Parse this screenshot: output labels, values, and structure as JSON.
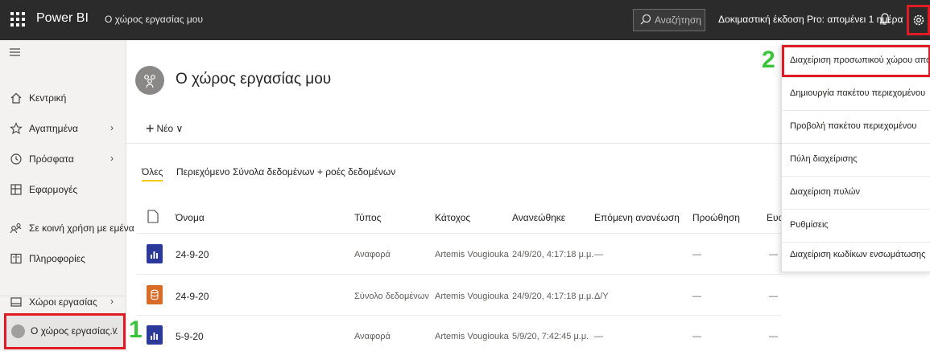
{
  "topbar": {
    "brand": "Power BI",
    "workspace_crumb": "Ο χώρος εργασίας μου",
    "search_placeholder": "Αναζήτηση",
    "trial_text": "Δοκιμαστική έκδοση Pro: απομένει 1 ημέρα"
  },
  "sidebar": {
    "items": [
      {
        "label": "Κεντρική",
        "icon": "home-icon"
      },
      {
        "label": "Αγαπημένα",
        "icon": "star-icon",
        "chevron": "›"
      },
      {
        "label": "Πρόσφατα",
        "icon": "clock-icon",
        "chevron": "›"
      },
      {
        "label": "Εφαρμογές",
        "icon": "apps-icon"
      },
      {
        "label": "Σε κοινή χρήση με εμένα",
        "icon": "shared-icon"
      },
      {
        "label": "Πληροφορίες",
        "icon": "learn-icon"
      },
      {
        "label": "Χώροι εργασίας",
        "icon": "workspaces-icon",
        "chevron": "›"
      }
    ],
    "active_workspace": {
      "label": "Ο χώρος εργασίας...",
      "chevron": "∨"
    }
  },
  "annotations": {
    "one": "1",
    "two": "2"
  },
  "main": {
    "title": "Ο χώρος εργασίας μου",
    "new_label": "Νέο ∨",
    "tabs": [
      "Όλες",
      "Περιεχόμενο",
      "Σύνολα δεδομένων + ροές δεδομένων"
    ],
    "active_tab": "Όλες",
    "columns": [
      "Όνομα",
      "Τύπος",
      "Κάτοχος",
      "Ανανεώθηκε",
      "Επόμενη ανανέωση",
      "Προώθηση",
      "Ευα"
    ],
    "rows": [
      {
        "kind": "report",
        "name": "24-9-20",
        "type": "Αναφορά",
        "owner": "Artemis Vougiouka",
        "refreshed": "24/9/20, 4:17:18 μ.μ.",
        "next": "—",
        "promoted": "—",
        "sens": "—"
      },
      {
        "kind": "dataset",
        "name": "24-9-20",
        "type": "Σύνολο δεδομένων",
        "owner": "Artemis Vougiouka",
        "refreshed": "24/9/20, 4:17:18 μ.μ.",
        "next": "Δ/Υ",
        "promoted": "—",
        "sens": "—"
      },
      {
        "kind": "report",
        "name": "5-9-20",
        "type": "Αναφορά",
        "owner": "Artemis Vougiouka",
        "refreshed": "5/9/20, 7:42:45 μ.μ.",
        "next": "—",
        "promoted": "—",
        "sens": "—"
      }
    ]
  },
  "settings_menu": {
    "items": [
      "Διαχείριση προσωπικού χώρου αποθή...",
      "Δημιουργία πακέτου περιεχομένου",
      "Προβολή πακέτου περιεχομένου",
      "Πύλη διαχείρισης",
      "Διαχείριση πυλών",
      "Ρυθμίσεις",
      "Διαχείριση κωδίκων ενσωμάτωσης"
    ]
  },
  "colors": {
    "topbar": "#2b2b2b",
    "highlight": "#e01b24",
    "annotation": "#3ac43a",
    "report_tile": "#2b3a9a",
    "dataset_tile": "#d86b26",
    "tab_accent": "#f2c811"
  }
}
